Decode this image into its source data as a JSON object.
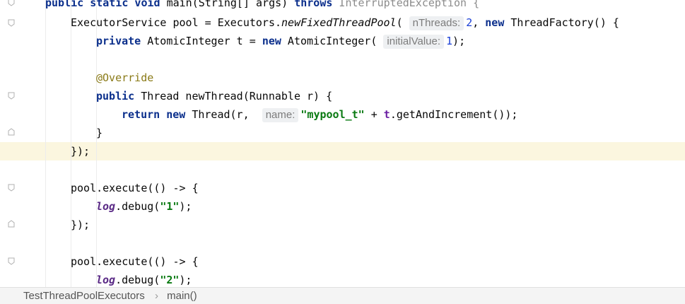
{
  "code": {
    "l0": {
      "kw1": "public static void",
      "a": " main(String[] args) ",
      "kw2": "throws",
      "b": " InterruptedException {"
    },
    "l1": {
      "a": "ExecutorService pool = Executors.",
      "m": "newFixedThreadPool",
      "b": "(",
      "hint": "nThreads:",
      "n": "2",
      ",": ", ",
      "kw": "new",
      "c": " ThreadFactory() {"
    },
    "l2": {
      "kw1": "private",
      "a": " AtomicInteger t = ",
      "kw2": "new",
      "b": " AtomicInteger(",
      "hint": "initialValue:",
      "n": "1",
      "c": ");"
    },
    "l4": {
      "ann": "@Override"
    },
    "l5": {
      "kw": "public",
      "a": " Thread newThread(Runnable r) {"
    },
    "l6": {
      "kw1": "return",
      "sp": " ",
      "kw2": "new",
      "a": " Thread(r, ",
      "hint": "name:",
      "s": "\"mypool_t\"",
      "b": " + ",
      "f": "t",
      "c": ".getAndIncrement());"
    },
    "l7": {
      "a": "}"
    },
    "l8": {
      "a": "});"
    },
    "l10": {
      "a": "pool.execute(() -> {"
    },
    "l11": {
      "it": "log",
      "a": ".debug(",
      "s": "\"1\"",
      "b": ");"
    },
    "l12": {
      "a": "});"
    },
    "l14": {
      "a": "pool.execute(() -> {"
    },
    "l15": {
      "it": "log",
      "a": ".debug(",
      "s": "\"2\"",
      "b": ");"
    }
  },
  "breadcrumb": {
    "item1": "TestThreadPoolExecutors",
    "sep": "›",
    "item2": "main()"
  }
}
